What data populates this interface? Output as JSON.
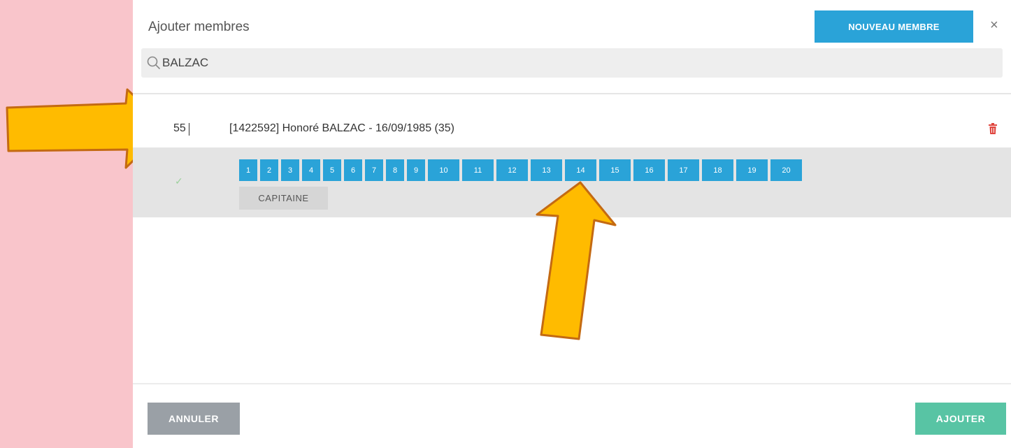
{
  "header": {
    "title": "Ajouter membres",
    "new_member_label": "NOUVEAU MEMBRE",
    "close_glyph": "×"
  },
  "search": {
    "value": "BALZAC",
    "icon": "search-icon"
  },
  "member": {
    "number": "55",
    "label": "[1422592] Honoré BALZAC - 16/09/1985 (35)",
    "delete_icon": "trash-icon",
    "selected_icon": "check-icon",
    "number_options": [
      "1",
      "2",
      "3",
      "4",
      "5",
      "6",
      "7",
      "8",
      "9",
      "10",
      "11",
      "12",
      "13",
      "14",
      "15",
      "16",
      "17",
      "18",
      "19",
      "20"
    ],
    "role_label": "CAPITAINE"
  },
  "footer": {
    "cancel_label": "ANNULER",
    "add_label": "AJOUTER"
  },
  "colors": {
    "background": "#f9c5cb",
    "primary_blue": "#2aa3d8",
    "add_green": "#58c4a4",
    "cancel_gray": "#9aa0a6",
    "delete_red": "#e0463f",
    "arrow_fill": "#ffbb00",
    "arrow_outline": "#c46a12"
  }
}
